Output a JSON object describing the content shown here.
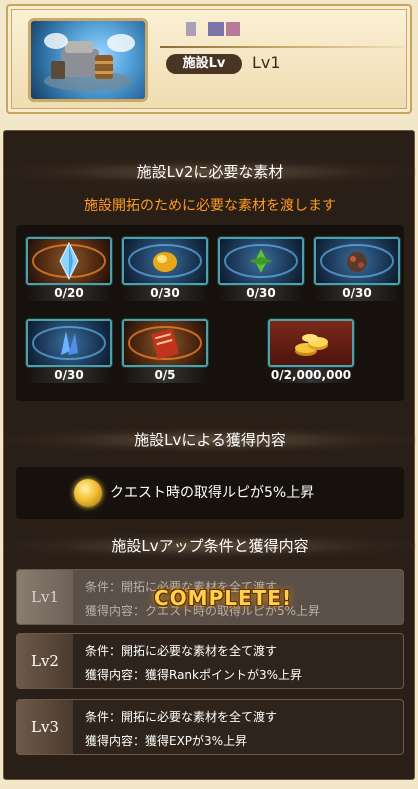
{
  "header": {
    "facility_lv_label": "施設Lv",
    "level_value": "Lv1"
  },
  "materials_section": {
    "title": "施設Lv2に必要な素材",
    "subtitle": "施設開拓のために必要な素材を渡します",
    "items": [
      {
        "icon": "crystal-icon",
        "count": "0/20"
      },
      {
        "icon": "gold-nugget-icon",
        "count": "0/30"
      },
      {
        "icon": "herb-leaf-icon",
        "count": "0/30"
      },
      {
        "icon": "ore-rock-icon",
        "count": "0/30"
      },
      {
        "icon": "blue-shard-icon",
        "count": "0/30"
      },
      {
        "icon": "scroll-icon",
        "count": "0/5"
      },
      {
        "icon": "rupie-coins-icon",
        "count": "0/2,000,000"
      }
    ]
  },
  "gain_section": {
    "title": "施設Lvによる獲得内容",
    "text": "クエスト時の取得ルピが5%上昇"
  },
  "conditions_section": {
    "title": "施設Lvアップ条件と獲得内容",
    "rows": [
      {
        "level": "Lv1",
        "condition": "条件：開拓に必要な素材を全て渡す",
        "reward": "獲得内容：クエスト時の取得ルピが5%上昇",
        "status": "COMPLETE!"
      },
      {
        "level": "Lv2",
        "condition": "条件：開拓に必要な素材を全て渡す",
        "reward": "獲得内容：獲得Rankポイントが3%上昇"
      },
      {
        "level": "Lv3",
        "condition": "条件：開拓に必要な素材を全て渡す",
        "reward": "獲得内容：獲得EXPが3%上昇"
      }
    ]
  },
  "colors": {
    "accent_orange": "#ff9b1f",
    "panel_bg": "#2a1f17",
    "tile_border": "#4fa0a8"
  }
}
